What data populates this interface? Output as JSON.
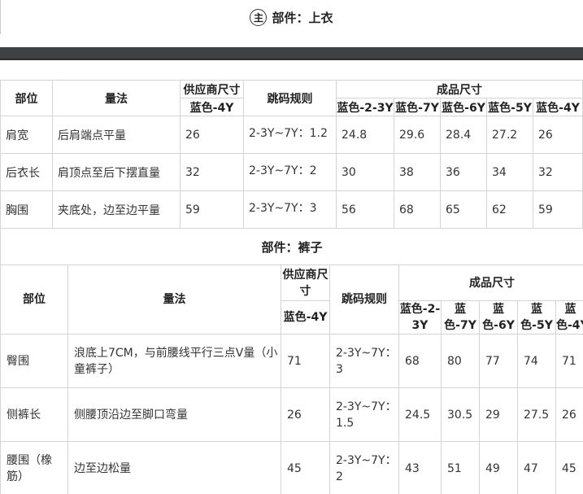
{
  "section1": {
    "icon_char": "主",
    "title": "部件：上衣",
    "headers": {
      "part": "部位",
      "method": "量法",
      "supplier": "供应商尺寸",
      "supplier_sub": "蓝色-4Y",
      "grading": "跳码规则",
      "finished": "成品尺寸",
      "sizes": [
        "蓝色-2-3Y",
        "蓝色-7Y",
        "蓝色-6Y",
        "蓝色-5Y",
        "蓝色-4Y"
      ]
    },
    "rows": [
      {
        "part": "肩宽",
        "method": "后肩端点平量",
        "supplier": "26",
        "grading": "2-3Y~7Y：1.2",
        "sizes": [
          "24.8",
          "29.6",
          "28.4",
          "27.2",
          "26"
        ]
      },
      {
        "part": "后衣长",
        "method": "肩顶点至后下摆直量",
        "supplier": "32",
        "grading": "2-3Y~7Y：2",
        "sizes": [
          "30",
          "38",
          "36",
          "34",
          "32"
        ]
      },
      {
        "part": "胸围",
        "method": "夹底处，边至边平量",
        "supplier": "59",
        "grading": "2-3Y~7Y：3",
        "sizes": [
          "56",
          "68",
          "65",
          "62",
          "59"
        ]
      }
    ]
  },
  "section2": {
    "title": "部件：裤子",
    "headers": {
      "part": "部位",
      "method": "量法",
      "supplier": "供应商尺寸",
      "supplier_sub": "蓝色-4Y",
      "grading": "跳码规则",
      "finished": "成品尺寸",
      "sizes": [
        "蓝色-2-3Y",
        "蓝色-7Y",
        "蓝色-6Y",
        "蓝色-5Y",
        "蓝色-4Y"
      ]
    },
    "rows": [
      {
        "part": "臀围",
        "method": "浪底上7CM，与前腰线平行三点V量（小童裤子）",
        "supplier": "71",
        "grading": "2-3Y~7Y：3",
        "sizes": [
          "68",
          "80",
          "77",
          "74",
          "71"
        ]
      },
      {
        "part": "侧裤长",
        "method": "侧腰顶沿边至脚口弯量",
        "supplier": "26",
        "grading": "2-3Y~7Y：1.5",
        "sizes": [
          "24.5",
          "30.5",
          "29",
          "27.5",
          "26"
        ]
      },
      {
        "part": "腰围（橡筋）",
        "method": "边至边松量",
        "supplier": "45",
        "grading": "2-3Y~7Y：2",
        "sizes": [
          "43",
          "51",
          "49",
          "47",
          "45"
        ]
      }
    ]
  },
  "colors": {
    "border": "#d4d4d4",
    "dark_bar": "#3f4244",
    "text": "#333333"
  }
}
